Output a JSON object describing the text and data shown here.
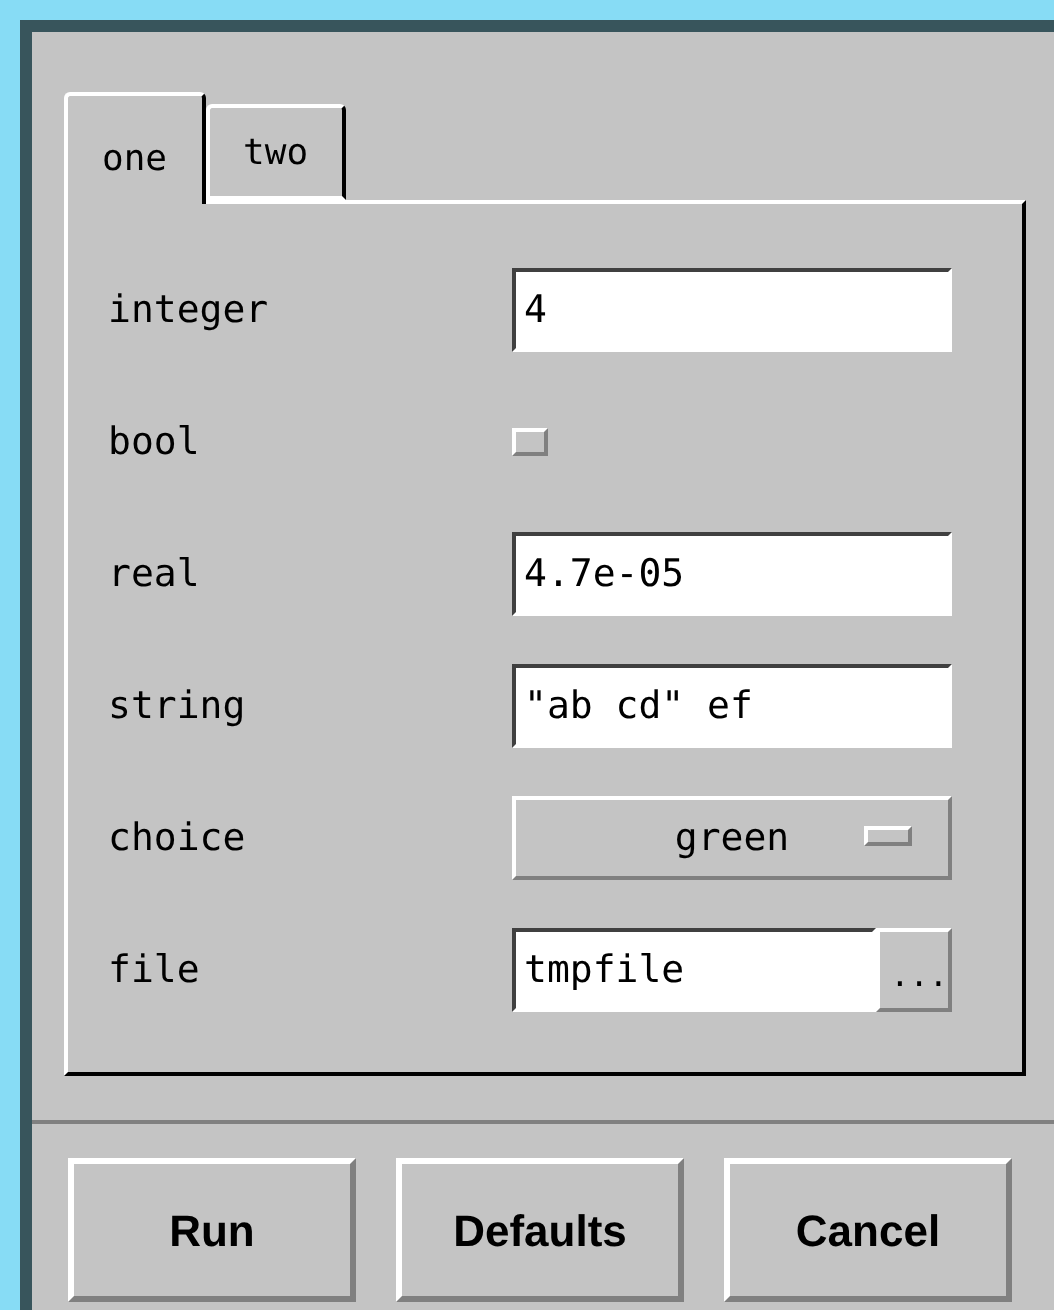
{
  "tabs": [
    {
      "label": "one",
      "selected": true
    },
    {
      "label": "two",
      "selected": false
    }
  ],
  "fields": [
    {
      "kind": "text",
      "label": "integer",
      "value": "4"
    },
    {
      "kind": "checkbox",
      "label": "bool",
      "checked": false
    },
    {
      "kind": "text",
      "label": "real",
      "value": "4.7e-05"
    },
    {
      "kind": "text",
      "label": "string",
      "value": "\"ab cd\" ef"
    },
    {
      "kind": "choice",
      "label": "choice",
      "value": "green"
    },
    {
      "kind": "file",
      "label": "file",
      "value": "tmpfile",
      "browse": "..."
    }
  ],
  "buttons": [
    "Run",
    "Defaults",
    "Cancel"
  ]
}
